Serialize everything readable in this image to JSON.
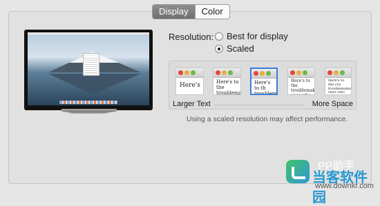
{
  "tabs": [
    {
      "label": "Display",
      "active": true
    },
    {
      "label": "Color",
      "active": false
    }
  ],
  "resolution": {
    "label": "Resolution:",
    "options": [
      {
        "label": "Best for display",
        "selected": false
      },
      {
        "label": "Scaled",
        "selected": true
      }
    ]
  },
  "scaled": {
    "thumbnails": [
      {
        "text": "Here's",
        "selected": false
      },
      {
        "text": "Here's to the\ntroublemake",
        "selected": false
      },
      {
        "text": "Here's to th\ntroublemak\nones who",
        "selected": true
      },
      {
        "text": "Here's to the\ntroublemakers,\nones who see\nthings different",
        "selected": false
      },
      {
        "text": "Here's to the cra\ntroublemakers,\nones who see thi\nthey have no res\ncan quote them,",
        "selected": false
      }
    ],
    "left_label": "Larger Text",
    "right_label": "More Space",
    "note": "Using a scaled resolution may affect performance."
  },
  "watermark": {
    "top_text": "PP助手",
    "brand": "当客软件园",
    "url": "www.downkr.com"
  },
  "colors": {
    "selection": "#3d7bd8",
    "tab_active_bg": "#7f7f7f"
  },
  "icons": [
    "monitor-icon",
    "close-dot",
    "minimize-dot",
    "zoom-dot"
  ]
}
